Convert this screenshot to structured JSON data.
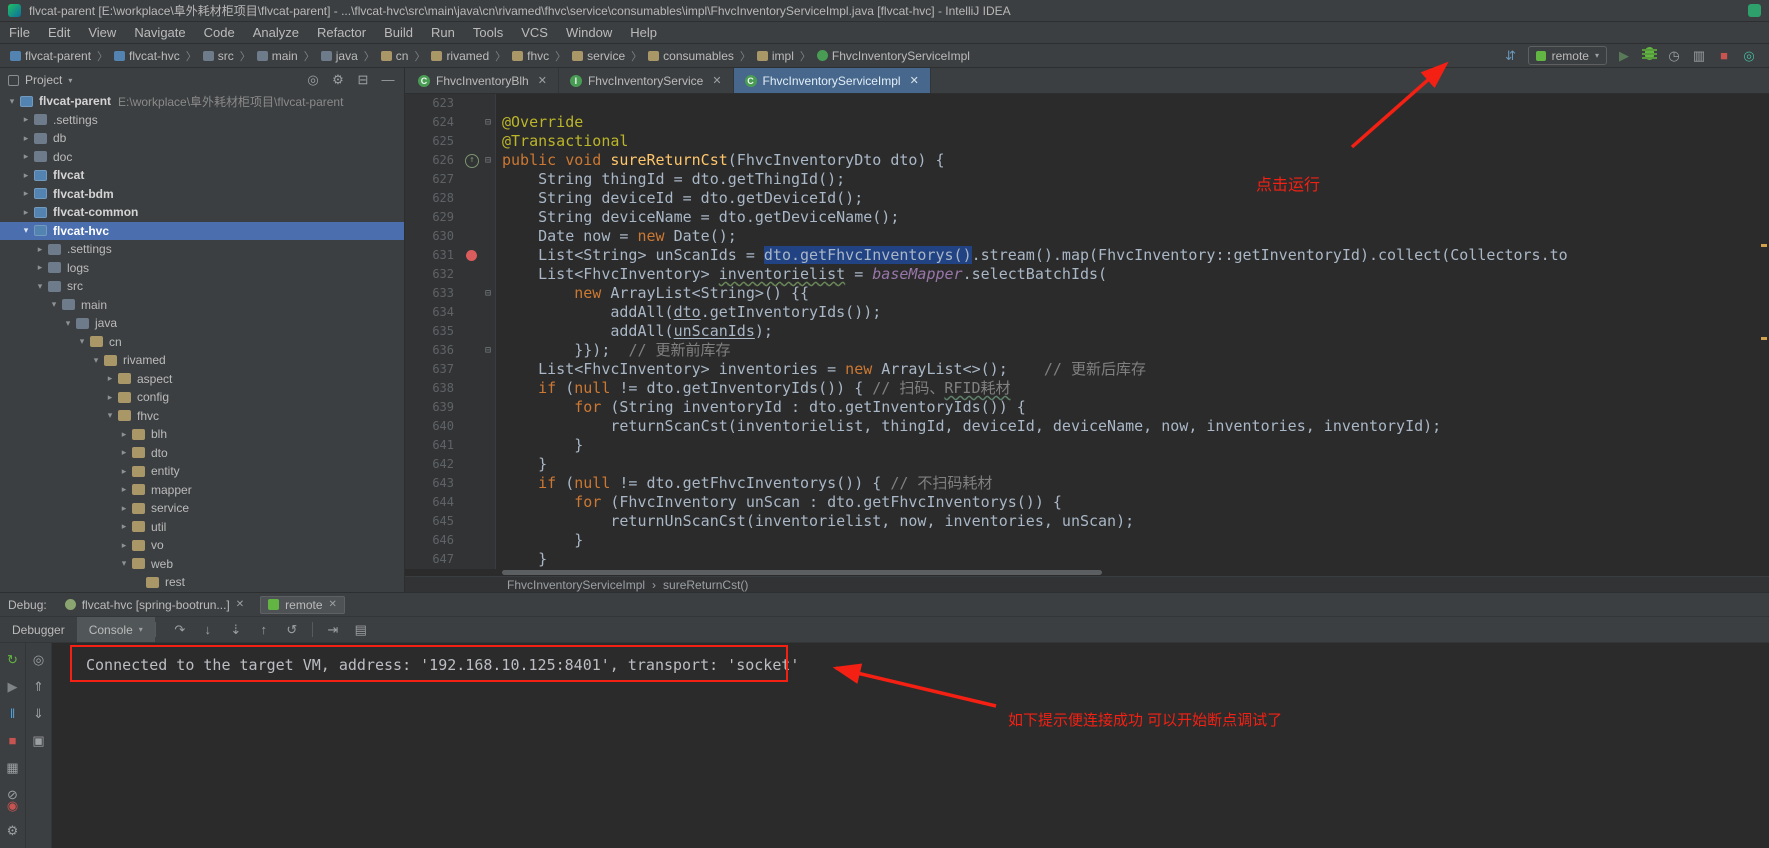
{
  "title_bar": {
    "title": "flvcat-parent [E:\\workplace\\阜外耗材柜项目\\flvcat-parent] - ...\\flvcat-hvc\\src\\main\\java\\cn\\rivamed\\fhvc\\service\\consumables\\impl\\FhvcInventoryServiceImpl.java [flvcat-hvc] - IntelliJ IDEA"
  },
  "menu_bar": {
    "items": [
      "File",
      "Edit",
      "View",
      "Navigate",
      "Code",
      "Analyze",
      "Refactor",
      "Build",
      "Run",
      "Tools",
      "VCS",
      "Window",
      "Help"
    ]
  },
  "nav_bar": {
    "crumbs": [
      {
        "label": "flvcat-parent",
        "icon": "module"
      },
      {
        "label": "flvcat-hvc",
        "icon": "module"
      },
      {
        "label": "src",
        "icon": "folder"
      },
      {
        "label": "main",
        "icon": "folder"
      },
      {
        "label": "java",
        "icon": "folder"
      },
      {
        "label": "cn",
        "icon": "package"
      },
      {
        "label": "rivamed",
        "icon": "package"
      },
      {
        "label": "fhvc",
        "icon": "package"
      },
      {
        "label": "service",
        "icon": "package"
      },
      {
        "label": "consumables",
        "icon": "package"
      },
      {
        "label": "impl",
        "icon": "package"
      },
      {
        "label": "FhvcInventoryServiceImpl",
        "icon": "class"
      }
    ],
    "run_config": "remote",
    "actions": [
      "build-icon",
      "run-config",
      "play-icon",
      "debug-icon",
      "profiler-icon",
      "coverage-icon",
      "stop-icon",
      "search-icon"
    ]
  },
  "annotations": {
    "run_hint": "点击运行",
    "debug_hint": "如下提示便连接成功 可以开始断点调试了"
  },
  "project_panel": {
    "header": "Project",
    "header_icons": [
      "locate-icon",
      "gear-icon",
      "collapse-all-icon",
      "hide-icon"
    ],
    "tree": [
      {
        "d": 0,
        "a": "v",
        "i": "module",
        "l": "flvcat-parent",
        "path": "E:\\workplace\\阜外耗材柜项目\\flvcat-parent",
        "b": true
      },
      {
        "d": 1,
        "a": ">",
        "i": "folder",
        "l": ".settings"
      },
      {
        "d": 1,
        "a": ">",
        "i": "folder",
        "l": "db"
      },
      {
        "d": 1,
        "a": ">",
        "i": "folder",
        "l": "doc"
      },
      {
        "d": 1,
        "a": ">",
        "i": "module",
        "l": "flvcat",
        "b": true
      },
      {
        "d": 1,
        "a": ">",
        "i": "module",
        "l": "flvcat-bdm",
        "b": true
      },
      {
        "d": 1,
        "a": ">",
        "i": "module",
        "l": "flvcat-common",
        "b": true
      },
      {
        "d": 1,
        "a": "v",
        "i": "module",
        "l": "flvcat-hvc",
        "b": true,
        "sel": true
      },
      {
        "d": 2,
        "a": ">",
        "i": "folder",
        "l": ".settings"
      },
      {
        "d": 2,
        "a": ">",
        "i": "folder",
        "l": "logs"
      },
      {
        "d": 2,
        "a": "v",
        "i": "folder",
        "l": "src"
      },
      {
        "d": 3,
        "a": "v",
        "i": "folder",
        "l": "main"
      },
      {
        "d": 4,
        "a": "v",
        "i": "folder",
        "l": "java"
      },
      {
        "d": 5,
        "a": "v",
        "i": "package",
        "l": "cn"
      },
      {
        "d": 6,
        "a": "v",
        "i": "package",
        "l": "rivamed"
      },
      {
        "d": 7,
        "a": ">",
        "i": "package",
        "l": "aspect"
      },
      {
        "d": 7,
        "a": ">",
        "i": "package",
        "l": "config"
      },
      {
        "d": 7,
        "a": "v",
        "i": "package",
        "l": "fhvc"
      },
      {
        "d": 8,
        "a": ">",
        "i": "package",
        "l": "blh"
      },
      {
        "d": 8,
        "a": ">",
        "i": "package",
        "l": "dto"
      },
      {
        "d": 8,
        "a": ">",
        "i": "package",
        "l": "entity"
      },
      {
        "d": 8,
        "a": ">",
        "i": "package",
        "l": "mapper"
      },
      {
        "d": 8,
        "a": ">",
        "i": "package",
        "l": "service"
      },
      {
        "d": 8,
        "a": ">",
        "i": "package",
        "l": "util"
      },
      {
        "d": 8,
        "a": ">",
        "i": "package",
        "l": "vo"
      },
      {
        "d": 8,
        "a": "v",
        "i": "package",
        "l": "web"
      },
      {
        "d": 9,
        "a": "",
        "i": "package",
        "l": "rest"
      }
    ]
  },
  "editor": {
    "tabs": [
      {
        "label": "FhvcInventoryBlh",
        "icon": "C",
        "active": false
      },
      {
        "label": "FhvcInventoryService",
        "icon": "I",
        "active": false
      },
      {
        "label": "FhvcInventoryServiceImpl",
        "icon": "C",
        "active": true
      }
    ],
    "breadcrumb": [
      "FhvcInventoryServiceImpl",
      "sureReturnCst()"
    ],
    "lines": [
      {
        "n": 623,
        "t": []
      },
      {
        "n": 624,
        "f": 1,
        "t": [
          [
            "an",
            "@Override"
          ]
        ]
      },
      {
        "n": 625,
        "t": [
          [
            "an",
            "@Transactional"
          ]
        ]
      },
      {
        "n": 626,
        "f": 1,
        "g": "override",
        "t": [
          [
            "k",
            "public void "
          ],
          [
            "fn",
            "sureReturnCst"
          ],
          [
            "df",
            "(FhvcInventoryDto dto) {"
          ]
        ]
      },
      {
        "n": 627,
        "t": [
          [
            "df",
            "    String thingId = dto.getThingId();"
          ]
        ]
      },
      {
        "n": 628,
        "t": [
          [
            "df",
            "    String deviceId = dto.getDeviceId();"
          ]
        ]
      },
      {
        "n": 629,
        "t": [
          [
            "df",
            "    String deviceName = dto.getDeviceName();"
          ]
        ]
      },
      {
        "n": 630,
        "t": [
          [
            "df",
            "    Date now = "
          ],
          [
            "k",
            "new"
          ],
          [
            "df",
            " Date();"
          ]
        ]
      },
      {
        "n": 631,
        "g": "breakpoint",
        "t": [
          [
            "df",
            "    List<String> unScanIds = "
          ],
          [
            "sel",
            "dto.getFhvcInventorys()"
          ],
          [
            "df",
            ".stream().map(FhvcInventory::getInventoryId).collect(Collectors.to"
          ]
        ]
      },
      {
        "n": 632,
        "t": [
          [
            "df",
            "    List<FhvcInventory> "
          ],
          [
            "tp",
            "inventorielist"
          ],
          [
            "df",
            " = "
          ],
          [
            "fd",
            "baseMapper"
          ],
          [
            "df",
            ".selectBatchIds("
          ]
        ]
      },
      {
        "n": 633,
        "f": 1,
        "t": [
          [
            "df",
            "        "
          ],
          [
            "k",
            "new"
          ],
          [
            "df",
            " ArrayList<String>() {{"
          ]
        ]
      },
      {
        "n": 634,
        "t": [
          [
            "df",
            "            addAll("
          ],
          [
            "lk",
            "dto"
          ],
          [
            "df",
            ".getInventoryIds());"
          ]
        ]
      },
      {
        "n": 635,
        "t": [
          [
            "df",
            "            addAll("
          ],
          [
            "lk",
            "unScanIds"
          ],
          [
            "df",
            ");"
          ]
        ]
      },
      {
        "n": 636,
        "f": 1,
        "t": [
          [
            "df",
            "        }});  "
          ],
          [
            "cm",
            "// 更新前库存"
          ]
        ]
      },
      {
        "n": 637,
        "t": [
          [
            "df",
            "    List<FhvcInventory> inventories = "
          ],
          [
            "k",
            "new"
          ],
          [
            "df",
            " ArrayList<>();    "
          ],
          [
            "cm",
            "// 更新后库存"
          ]
        ]
      },
      {
        "n": 638,
        "t": [
          [
            "df",
            "    "
          ],
          [
            "k",
            "if"
          ],
          [
            "df",
            " ("
          ],
          [
            "k",
            "null"
          ],
          [
            "df",
            " != dto.getInventoryIds()) { "
          ],
          [
            "cm",
            "// 扫码、"
          ],
          [
            "cmu",
            "RFID耗材"
          ]
        ]
      },
      {
        "n": 639,
        "t": [
          [
            "df",
            "        "
          ],
          [
            "k",
            "for"
          ],
          [
            "df",
            " (String inventoryId : dto.getInventoryIds()) {"
          ]
        ]
      },
      {
        "n": 640,
        "t": [
          [
            "df",
            "            returnScanCst(inventorielist, thingId, deviceId, deviceName, now, inventories, inventoryId);"
          ]
        ]
      },
      {
        "n": 641,
        "t": [
          [
            "df",
            "        }"
          ]
        ]
      },
      {
        "n": 642,
        "t": [
          [
            "df",
            "    }"
          ]
        ]
      },
      {
        "n": 643,
        "t": [
          [
            "df",
            "    "
          ],
          [
            "k",
            "if"
          ],
          [
            "df",
            " ("
          ],
          [
            "k",
            "null"
          ],
          [
            "df",
            " != dto.getFhvcInventorys()) { "
          ],
          [
            "cm",
            "// 不扫码耗材"
          ]
        ]
      },
      {
        "n": 644,
        "t": [
          [
            "df",
            "        "
          ],
          [
            "k",
            "for"
          ],
          [
            "df",
            " (FhvcInventory unScan : dto.getFhvcInventorys()) {"
          ]
        ]
      },
      {
        "n": 645,
        "t": [
          [
            "df",
            "            returnUnScanCst(inventorielist, now, inventories, unScan);"
          ]
        ]
      },
      {
        "n": 646,
        "t": [
          [
            "df",
            "        }"
          ]
        ]
      },
      {
        "n": 647,
        "t": [
          [
            "df",
            "    }"
          ]
        ]
      }
    ]
  },
  "debug_panel": {
    "label": "Debug:",
    "session_tabs": [
      {
        "label": "flvcat-hvc [spring-bootrun...]",
        "icon": "spring-icon",
        "active": false
      },
      {
        "label": "remote",
        "icon": "remote-icon",
        "active": true
      }
    ],
    "view_tabs": [
      {
        "label": "Debugger",
        "active": false
      },
      {
        "label": "Console",
        "active": true
      }
    ],
    "step_toolbar": [
      "step-over-icon",
      "step-into-icon",
      "force-step-into-icon",
      "step-out-icon",
      "drop-frame-icon",
      "run-to-cursor-icon",
      "evaluate-expression-icon"
    ],
    "left_toolbar": [
      "rerun-icon",
      "resume-icon",
      "pause-icon",
      "stop-debug-icon",
      "restore-layout-icon",
      "mute-breakpoints-icon"
    ],
    "left_toolbar_bottom": [
      "view-breakpoints-icon",
      "settings-icon"
    ],
    "left_toolbar2": [
      "show-execution-point-icon",
      "frame-up-icon",
      "frame-down-icon",
      "tab-pin-icon"
    ],
    "console_text": "Connected to the target VM, address: '192.168.10.125:8401', transport: 'socket'"
  }
}
